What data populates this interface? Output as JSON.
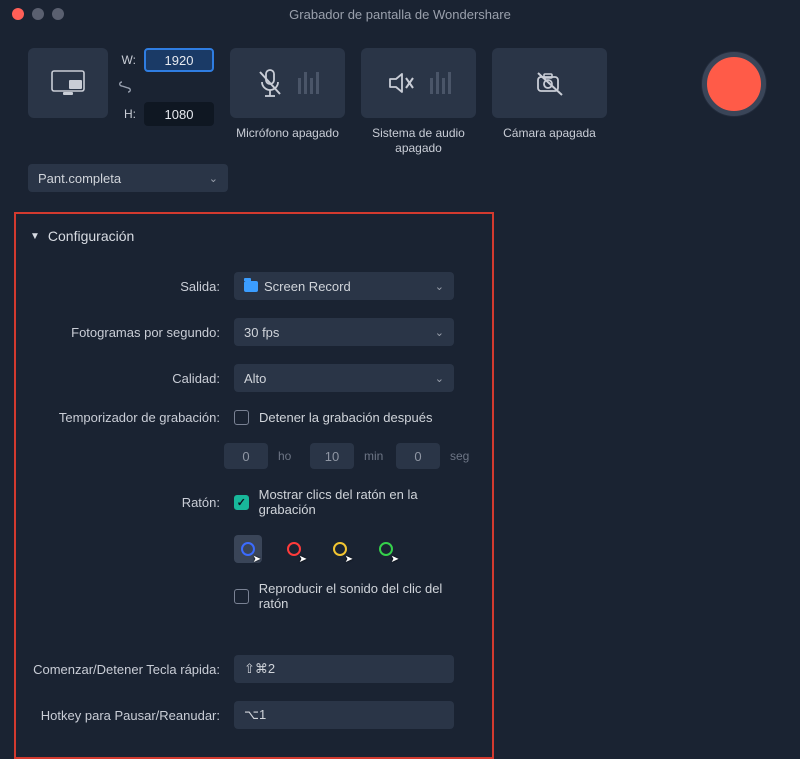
{
  "window": {
    "title": "Grabador de pantalla de Wondershare"
  },
  "dimensions": {
    "w_label": "W:",
    "h_label": "H:",
    "width": "1920",
    "height": "1080"
  },
  "screen_select": {
    "value": "Pant.completa"
  },
  "devices": {
    "mic": "Micrófono apagado",
    "system_audio": "Sistema de audio apagado",
    "camera": "Cámara apagada"
  },
  "config": {
    "header": "Configuración",
    "output_label": "Salida:",
    "output_value": "Screen Record",
    "fps_label": "Fotogramas por segundo:",
    "fps_value": "30 fps",
    "quality_label": "Calidad:",
    "quality_value": "Alto",
    "timer_label": "Temporizador de grabación:",
    "timer_stop_after": "Detener la grabación después",
    "timer_ho": "0",
    "timer_ho_unit": "ho",
    "timer_min": "10",
    "timer_min_unit": "min",
    "timer_seg": "0",
    "timer_seg_unit": "seg",
    "mouse_label": "Ratón:",
    "mouse_show_clicks": "Mostrar clics del ratón en la grabación",
    "mouse_play_sound": "Reproducir el sonido del clic del ratón",
    "cursor_colors": [
      "#3b6bff",
      "#ff3b3b",
      "#f2c531",
      "#35d14b"
    ],
    "hotkey_startstop_label": "Comenzar/Detener Tecla rápida:",
    "hotkey_startstop_value": "⇧⌘2",
    "hotkey_pause_label": "Hotkey para Pausar/Reanudar:",
    "hotkey_pause_value": "⌥1"
  }
}
